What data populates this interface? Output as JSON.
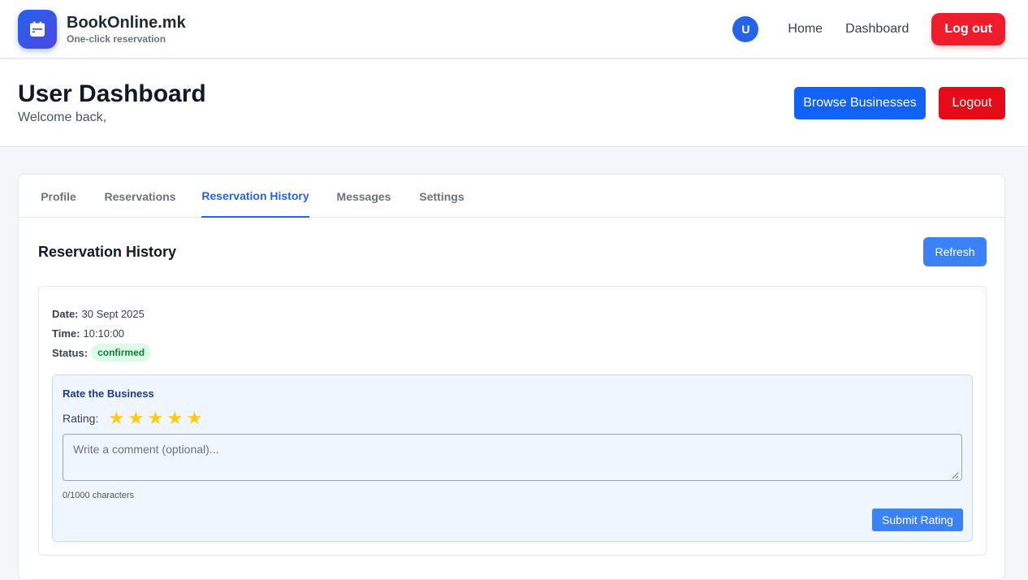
{
  "navbar": {
    "brand_name": "BookOnline.mk",
    "brand_tagline": "One-click reservation",
    "logo_icon": "calendar-icon",
    "avatar_initial": "U",
    "links": [
      "Home",
      "Dashboard"
    ],
    "logout_label": "Log out",
    "colors": {
      "primary": "#2563eb",
      "danger": "#ef1c2b"
    }
  },
  "header": {
    "title": "User Dashboard",
    "subtitle": "Welcome back,",
    "browse_label": "Browse Businesses",
    "logout_label": "Logout"
  },
  "tabs": [
    {
      "label": "Profile"
    },
    {
      "label": "Reservations"
    },
    {
      "label": "Reservation History",
      "active": true
    },
    {
      "label": "Messages"
    },
    {
      "label": "Settings"
    }
  ],
  "history": {
    "title": "Reservation History",
    "refresh_label": "Refresh",
    "reservation": {
      "date_label": "Date:",
      "date": "30 Sept 2025",
      "time_label": "Time:",
      "time": "10:10:00",
      "status_label": "Status:",
      "status": "confirmed",
      "status_color": "#15803d"
    },
    "rating": {
      "title": "Rate the Business",
      "rating_label": "Rating:",
      "stars": 5,
      "star_icon": "star-icon",
      "comment_placeholder": "Write a comment (optional)...",
      "comment_value": "",
      "char_count": "0/1000 characters",
      "submit_label": "Submit Rating"
    }
  }
}
